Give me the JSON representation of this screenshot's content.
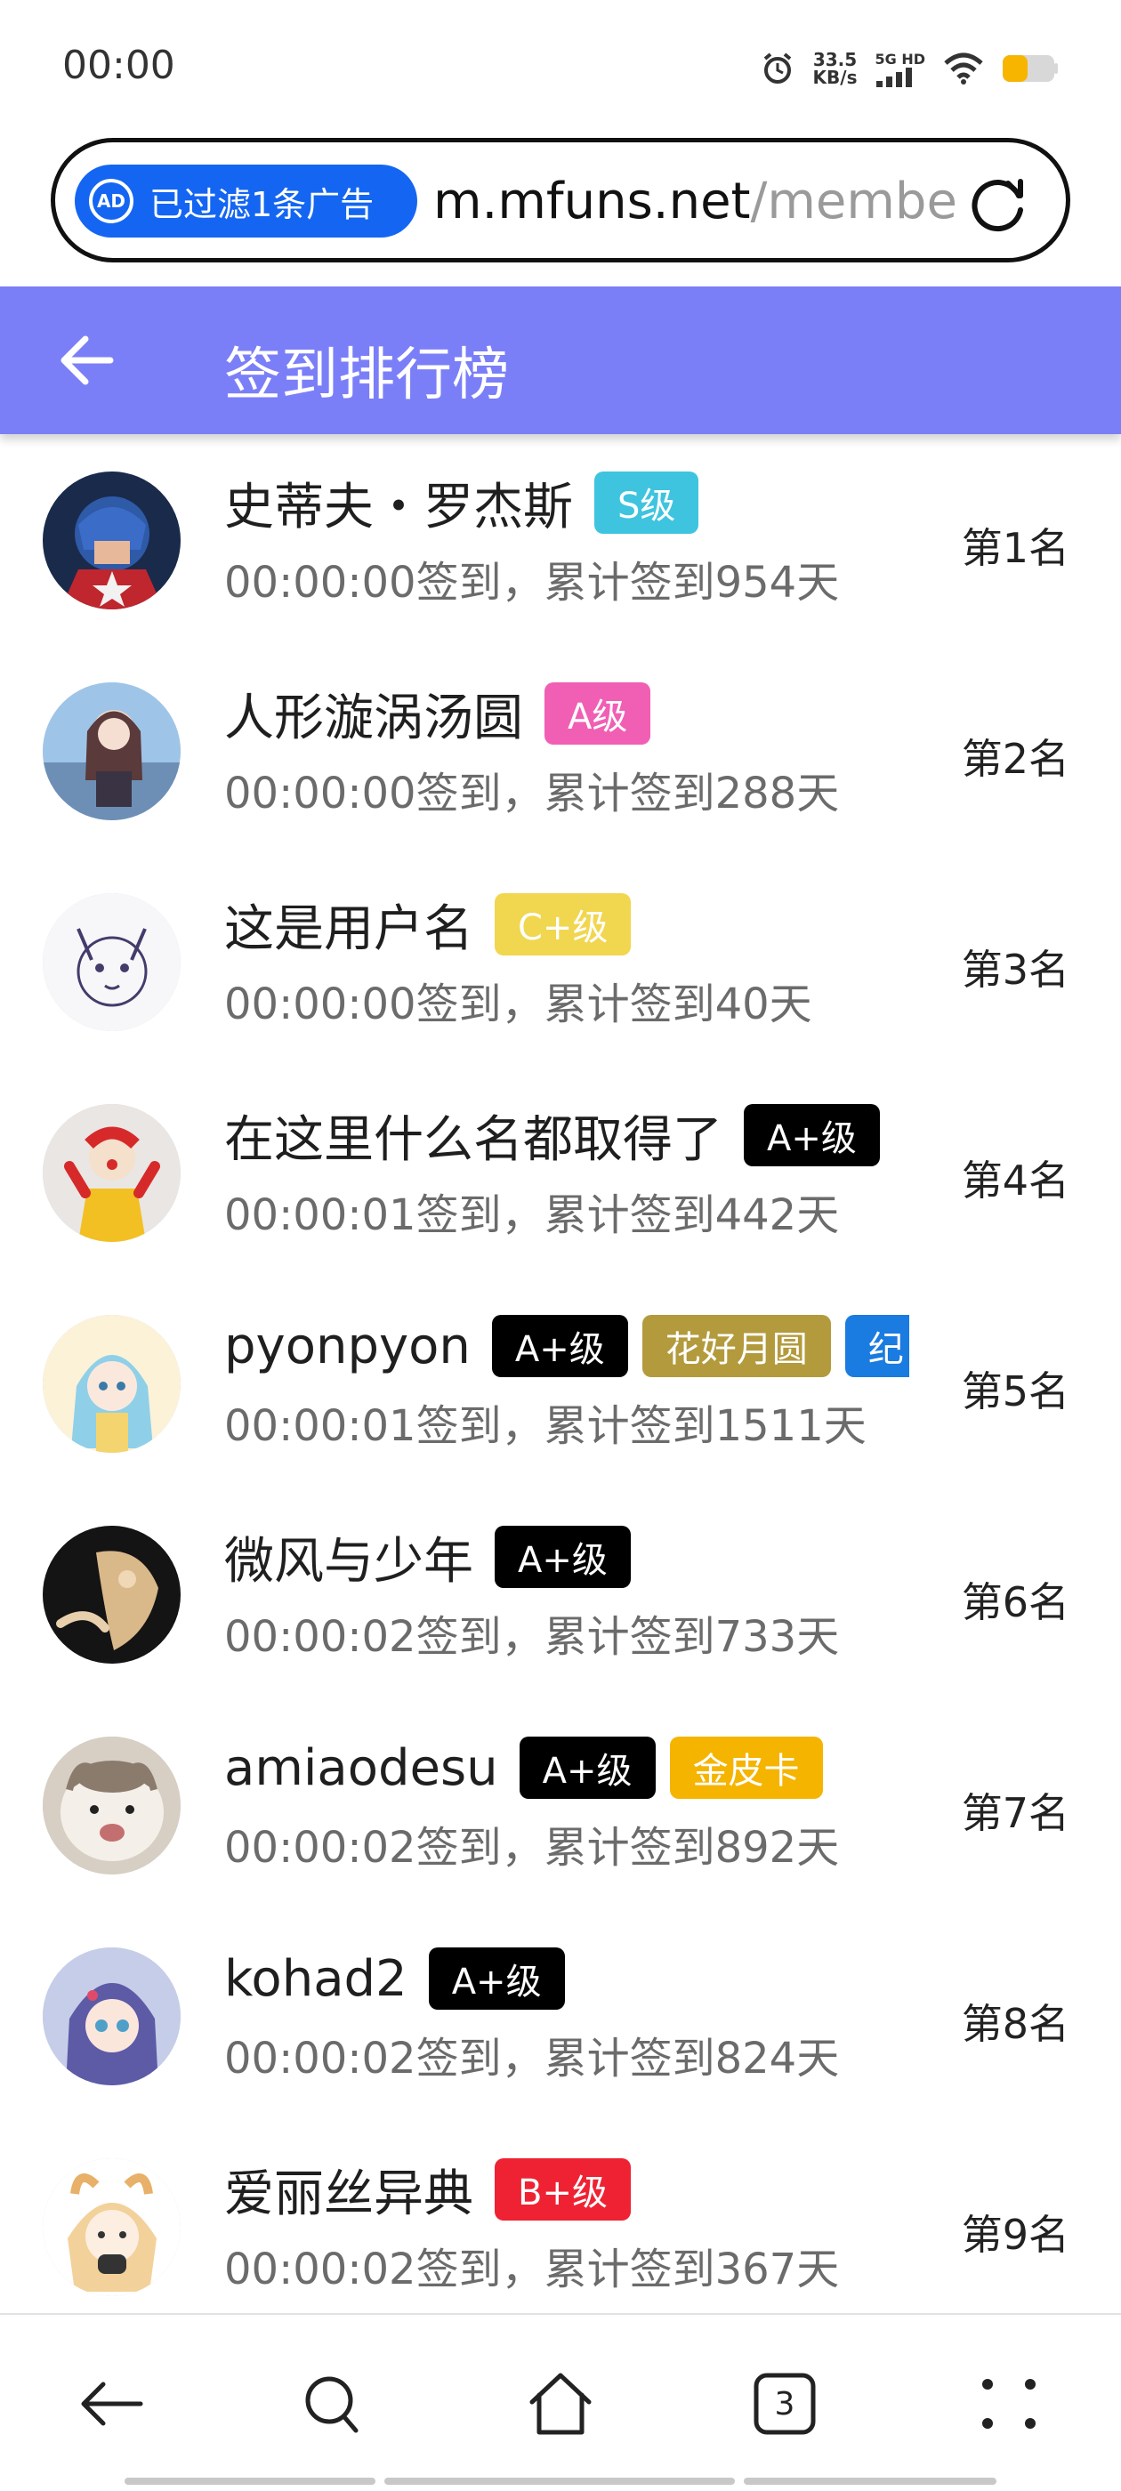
{
  "status": {
    "time": "00:00",
    "speed_value": "33.5",
    "speed_unit": "KB/s",
    "network": "5G HD"
  },
  "browser": {
    "ad_badge": "已过滤1条广告",
    "ad_icon_text": "AD",
    "url_host": "m.mfuns.net",
    "url_path": "/membe"
  },
  "header": {
    "title": "签到排行榜"
  },
  "rows": [
    {
      "name": "史蒂夫・罗杰斯",
      "tags": [
        {
          "label": "S级",
          "color": "#3ec4df",
          "text_color": "#ffffff"
        }
      ],
      "info": "00:00:00签到，累计签到954天",
      "rank": "第1名",
      "avatar": "captain-avatar"
    },
    {
      "name": "人形漩涡汤圆",
      "tags": [
        {
          "label": "A级",
          "color": "#f05fb4",
          "text_color": "#ffffff"
        }
      ],
      "info": "00:00:00签到，累计签到288天",
      "rank": "第2名",
      "avatar": "anime-girl-avatar"
    },
    {
      "name": "这是用户名",
      "tags": [
        {
          "label": "C+级",
          "color": "#f1d64f",
          "text_color": "#ffffff"
        }
      ],
      "info": "00:00:00签到，累计签到40天",
      "rank": "第3名",
      "avatar": "sketch-cat-avatar"
    },
    {
      "name": "在这里什么名都取得了",
      "tags": [
        {
          "label": "A+级",
          "color": "#000000",
          "text_color": "#ffffff"
        }
      ],
      "info": "00:00:01签到，累计签到442天",
      "rank": "第4名",
      "avatar": "clown-avatar"
    },
    {
      "name": "pyonpyon",
      "tags": [
        {
          "label": "A+级",
          "color": "#000000",
          "text_color": "#ffffff"
        },
        {
          "label": "花好月圆",
          "color": "#b39a3c",
          "text_color": "#ffffff"
        },
        {
          "label": "纪",
          "color": "#1a7be0",
          "text_color": "#ffffff"
        }
      ],
      "info": "00:00:01签到，累计签到1511天",
      "rank": "第5名",
      "avatar": "blue-hair-avatar"
    },
    {
      "name": "微风与少年",
      "tags": [
        {
          "label": "A+级",
          "color": "#000000",
          "text_color": "#ffffff"
        }
      ],
      "info": "00:00:02签到，累计签到733天",
      "rank": "第6名",
      "avatar": "dark-art-avatar"
    },
    {
      "name": "amiaodesu",
      "tags": [
        {
          "label": "A+级",
          "color": "#000000",
          "text_color": "#ffffff"
        },
        {
          "label": "金皮卡",
          "color": "#f5b400",
          "text_color": "#ffffff"
        }
      ],
      "info": "00:00:02签到，累计签到892天",
      "rank": "第7名",
      "avatar": "cat-avatar"
    },
    {
      "name": "kohad2",
      "tags": [
        {
          "label": "A+级",
          "color": "#000000",
          "text_color": "#ffffff"
        }
      ],
      "info": "00:00:02签到，累计签到824天",
      "rank": "第8名",
      "avatar": "purple-hair-avatar"
    },
    {
      "name": "爱丽丝异典",
      "tags": [
        {
          "label": "B+级",
          "color": "#ee2233",
          "text_color": "#ffffff"
        }
      ],
      "info": "00:00:02签到，累计签到367天",
      "rank": "第9名",
      "avatar": "blonde-chibi-avatar"
    }
  ],
  "bottom_nav": {
    "tab_count": "3"
  }
}
